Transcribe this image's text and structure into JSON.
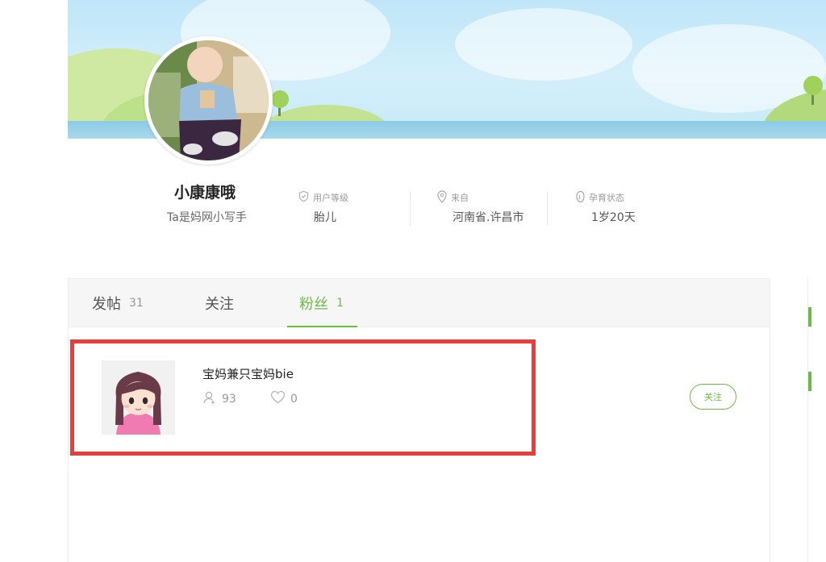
{
  "profile": {
    "username": "小康康哦",
    "subtitle": "Ta是妈网小写手",
    "stats": [
      {
        "label": "用户等级",
        "value": "胎儿",
        "icon": "shield-icon"
      },
      {
        "label": "来自",
        "value": "河南省.许昌市",
        "icon": "location-pin-icon"
      },
      {
        "label": "孕育状态",
        "value": "1岁20天",
        "icon": "baby-bottle-icon"
      }
    ]
  },
  "tabs": [
    {
      "label": "发帖",
      "count": "31"
    },
    {
      "label": "关注",
      "count": ""
    },
    {
      "label": "粉丝",
      "count": "1"
    }
  ],
  "active_tab": "粉丝",
  "fans": [
    {
      "name": "宝妈兼只宝妈bie",
      "followers": "93",
      "likes": "0",
      "follow_label": "关注"
    }
  ],
  "colors": {
    "accent": "#6cbb45",
    "highlight": "#e83d3d",
    "tab_bar_bg": "#f6f6f6"
  }
}
